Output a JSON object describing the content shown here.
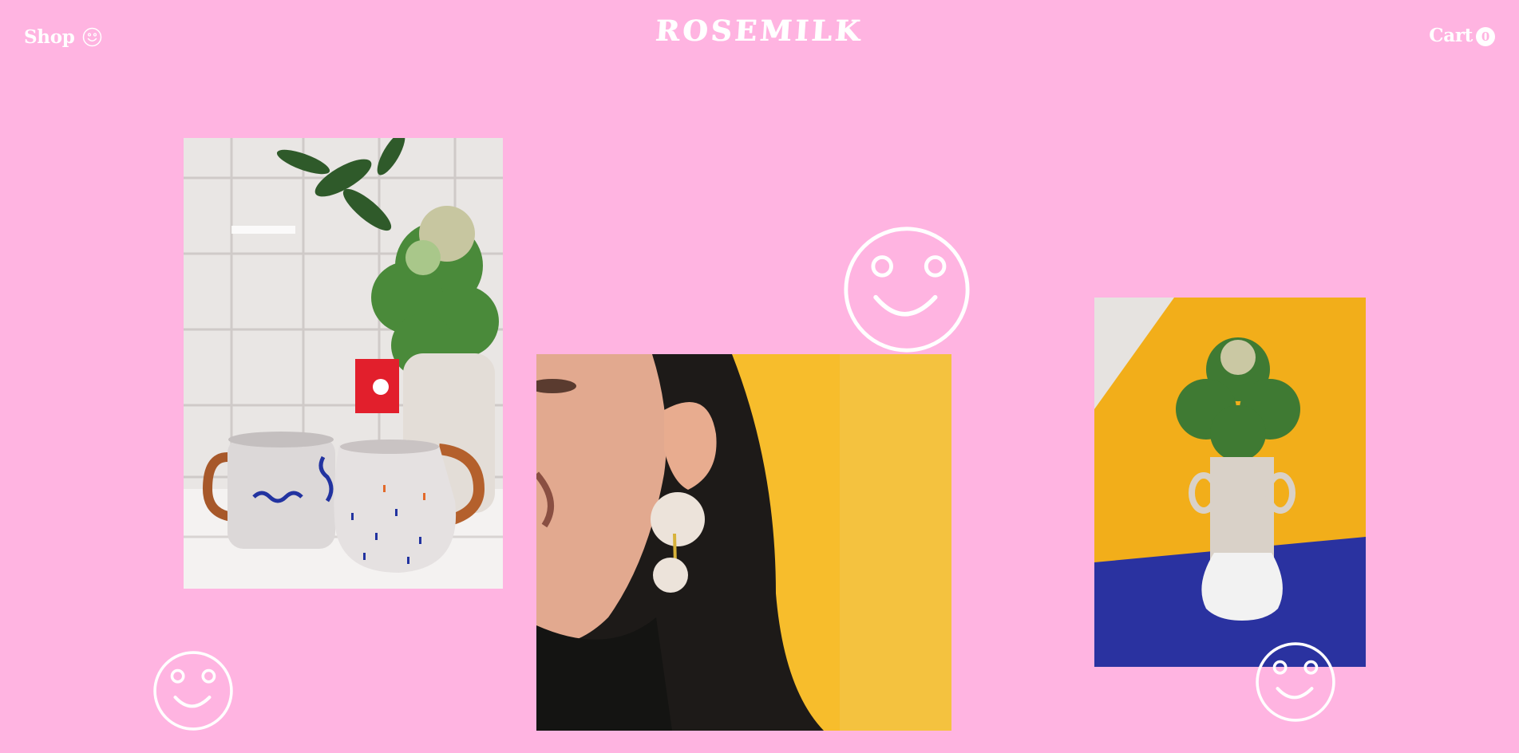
{
  "header": {
    "shop_label": "Shop",
    "brand": "ROSEMILK",
    "cart_label": "Cart",
    "cart_count": "0"
  },
  "photos": [
    {
      "name": "ceramic-mugs-and-vase",
      "subject": "two speckled ceramic mugs in front of a white tile wall with a kale plant in a vase"
    },
    {
      "name": "ceramic-earring-model",
      "subject": "smiling woman wearing a round white ceramic drop earring against a yellow wall"
    },
    {
      "name": "kale-in-ceramic-vase",
      "subject": "ornamental kale in a handled ceramic vase on yellow and blue paper"
    }
  ],
  "icons": {
    "shop": "smiley-icon",
    "decor": [
      "smiley-icon",
      "smiley-icon",
      "smiley-icon"
    ]
  },
  "colors": {
    "background": "#ffb4e1",
    "foreground": "#ffffff",
    "yellow": "#f7bd2c",
    "blue": "#2a32a0",
    "green": "#3f7a33"
  }
}
